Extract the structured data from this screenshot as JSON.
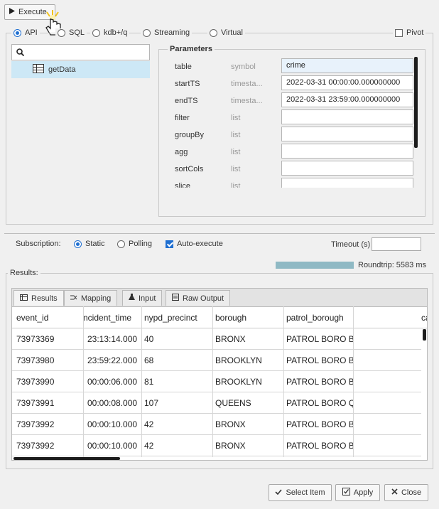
{
  "toolbar": {
    "execute_label": "Execute"
  },
  "modes": {
    "api": "API",
    "sql": "SQL",
    "kdb": "kdb+/q",
    "streaming": "Streaming",
    "virtual": "Virtual",
    "pivot": "Pivot"
  },
  "tree": {
    "item": "getData"
  },
  "params": {
    "legend": "Parameters",
    "rows": [
      {
        "name": "table",
        "type": "symbol",
        "value": "crime"
      },
      {
        "name": "startTS",
        "type": "timesta...",
        "value": "2022-03-31 00:00:00.000000000"
      },
      {
        "name": "endTS",
        "type": "timesta...",
        "value": "2022-03-31 23:59:00.000000000"
      },
      {
        "name": "filter",
        "type": "list",
        "value": ""
      },
      {
        "name": "groupBy",
        "type": "list",
        "value": ""
      },
      {
        "name": "agg",
        "type": "list",
        "value": ""
      },
      {
        "name": "sortCols",
        "type": "list",
        "value": ""
      },
      {
        "name": "slice",
        "type": "list",
        "value": ""
      }
    ]
  },
  "subscription": {
    "label": "Subscription:",
    "static": "Static",
    "polling": "Polling",
    "auto": "Auto-execute",
    "timeout_label": "Timeout (s)",
    "timeout_value": ""
  },
  "roundtrip": {
    "label": "Roundtrip: 5583 ms"
  },
  "results": {
    "legend": "Results:",
    "tabs": [
      "Results",
      "Mapping",
      "Input",
      "Raw Output"
    ],
    "columns": [
      "event_id",
      "ncident_time",
      "nypd_precinct",
      "borough",
      "patrol_borough",
      "ca"
    ],
    "rows": [
      [
        "73973369",
        "23:13:14.000",
        "40",
        "BRONX",
        "PATROL BORO B"
      ],
      [
        "73973980",
        "23:59:22.000",
        "68",
        "BROOKLYN",
        "PATROL BORO B"
      ],
      [
        "73973990",
        "00:00:06.000",
        "81",
        "BROOKLYN",
        "PATROL BORO B"
      ],
      [
        "73973991",
        "00:00:08.000",
        "107",
        "QUEENS",
        "PATROL BORO Q"
      ],
      [
        "73973992",
        "00:00:10.000",
        "42",
        "BRONX",
        "PATROL BORO B"
      ],
      [
        "73973992",
        "00:00:10.000",
        "42",
        "BRONX",
        "PATROL BORO B"
      ]
    ]
  },
  "footer": {
    "select": "Select Item",
    "apply": "Apply",
    "close": "Close"
  },
  "colors": {
    "accent": "#1f6fd1",
    "selection": "#cde8f6",
    "progress": "#8fb9c4"
  }
}
